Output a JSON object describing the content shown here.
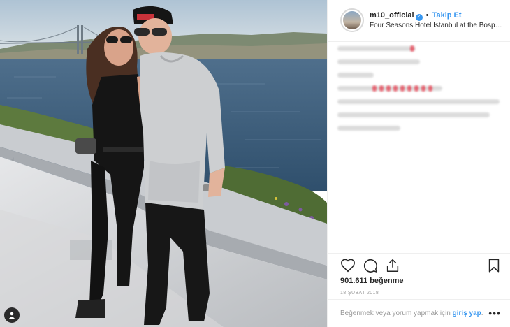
{
  "post": {
    "username": "m10_official",
    "verified_icon": "verified-badge-icon",
    "separator": "•",
    "follow_label": "Takip Et",
    "location": "Four Seasons Hotel Istanbul at the Bospho...",
    "likes": "901.611 beğenme",
    "date": "18 ŞUBAT 2018",
    "login_prompt": "Beğenmek veya yorum yapmak için",
    "login_link": "giriş yap",
    "login_suffix": ".",
    "more_label": "•••"
  },
  "icons": {
    "like": "heart-icon",
    "comment": "comment-icon",
    "share": "share-icon",
    "save": "bookmark-icon",
    "tag": "user-tag-icon"
  },
  "colors": {
    "accent": "#3897f0",
    "text": "#262626",
    "muted": "#999999",
    "border": "#efefef"
  }
}
